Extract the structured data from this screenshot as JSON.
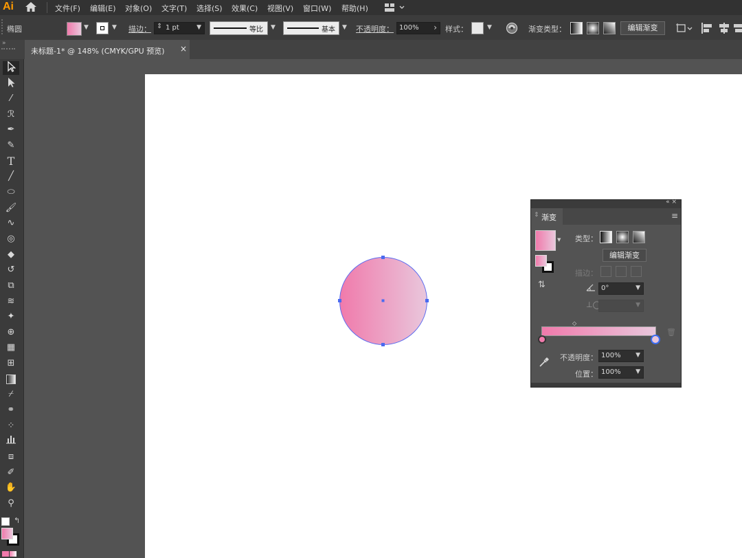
{
  "app": {
    "logo": "Ai"
  },
  "menu": [
    "文件(F)",
    "编辑(E)",
    "对象(O)",
    "文字(T)",
    "选择(S)",
    "效果(C)",
    "视图(V)",
    "窗口(W)",
    "帮助(H)"
  ],
  "control_bar": {
    "object_type": "椭圆",
    "stroke_label": "描边：",
    "stroke_weight": "1 pt",
    "profile_label": "等比",
    "brush_label": "基本",
    "opacity_label": "不透明度：",
    "opacity_value": "100%",
    "style_label": "样式：",
    "gradient_type_label": "渐变类型：",
    "edit_gradient_button": "编辑渐变",
    "fill_gradient_start": "#f07aab",
    "fill_gradient_end": "#e9c7dc"
  },
  "document": {
    "tab_title": "未标题-1* @ 148% (CMYK/GPU 预览)",
    "close": "×"
  },
  "toolbar_icons": [
    "selection-tool-icon",
    "direct-selection-tool-icon",
    "magic-wand-icon",
    "lasso-icon",
    "pen-tool-icon",
    "curvature-tool-icon",
    "type-tool-icon",
    "line-tool-icon",
    "ellipse-tool-icon",
    "paintbrush-icon",
    "shaper-tool-icon",
    "rotate-tool-icon",
    "eraser-icon",
    "rotate-view-icon",
    "scale-tool-icon",
    "width-tool-icon",
    "puppet-warp-icon",
    "shape-builder-icon",
    "perspective-grid-icon",
    "mesh-tool-icon",
    "gradient-tool-icon",
    "eyedropper-icon",
    "blend-tool-icon",
    "symbol-sprayer-icon",
    "column-graph-icon",
    "artboard-tool-icon",
    "slice-tool-icon",
    "hand-tool-icon",
    "zoom-tool-icon"
  ],
  "gradient_panel": {
    "panel_top_icons": "«  ×",
    "tab_label": "渐变",
    "type_label": "类型：",
    "edit_gradient_button": "编辑渐变",
    "stroke_label": "描边：",
    "angle_value": "0°",
    "opacity_label": "不透明度：",
    "opacity_value": "100%",
    "location_label": "位置：",
    "location_value": "100%",
    "start_color": "#f07aab",
    "end_color": "#e9c7dc"
  }
}
